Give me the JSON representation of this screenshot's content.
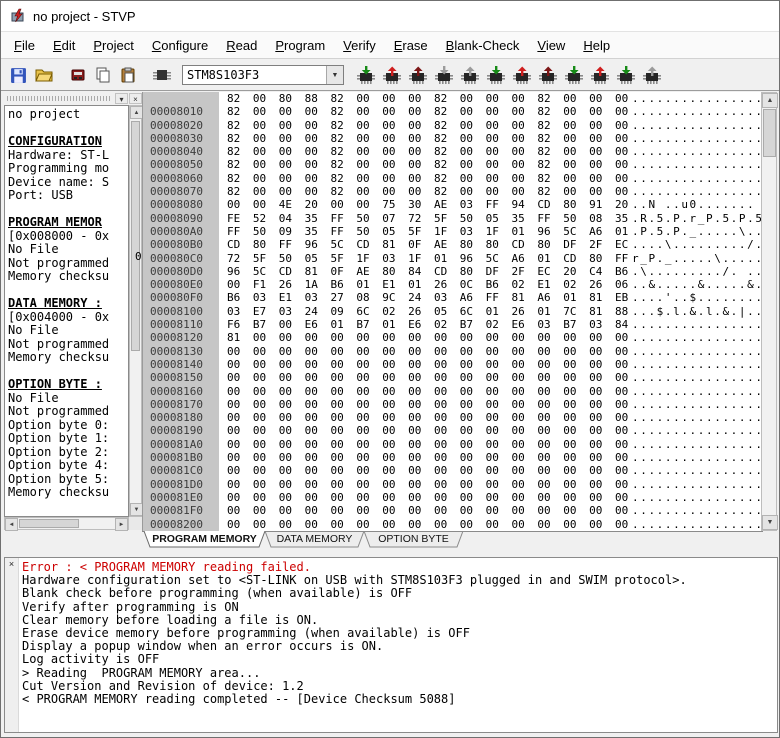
{
  "window": {
    "title": "no project - STVP"
  },
  "menu": {
    "items": [
      {
        "label": "File",
        "u": 0
      },
      {
        "label": "Edit",
        "u": 0
      },
      {
        "label": "Project",
        "u": 0
      },
      {
        "label": "Configure",
        "u": 0
      },
      {
        "label": "Read",
        "u": 0
      },
      {
        "label": "Program",
        "u": 0
      },
      {
        "label": "Verify",
        "u": 0
      },
      {
        "label": "Erase",
        "u": 0
      },
      {
        "label": "Blank-Check",
        "u": 0
      },
      {
        "label": "View",
        "u": 0
      },
      {
        "label": "Help",
        "u": 0
      }
    ]
  },
  "toolbar": {
    "left_icons": [
      "save",
      "open",
      "sep",
      "programmer",
      "copy",
      "paste",
      "sep",
      "chip"
    ],
    "device_value": "STM8S103F3",
    "chips": [
      {
        "color": "green",
        "dir": "down"
      },
      {
        "color": "red",
        "dir": "up"
      },
      {
        "color": "maroon",
        "dir": "up"
      },
      {
        "color": "gray",
        "dir": "down"
      },
      {
        "color": "gray",
        "dir": "up"
      },
      {
        "color": "green",
        "dir": "down"
      },
      {
        "color": "red",
        "dir": "up"
      },
      {
        "color": "maroon",
        "dir": "up"
      },
      {
        "color": "green",
        "dir": "down"
      },
      {
        "color": "red",
        "dir": "up"
      },
      {
        "color": "green",
        "dir": "down"
      },
      {
        "color": "gray",
        "dir": "up"
      }
    ]
  },
  "icons": {
    "arrow_up": "▲",
    "arrow_down": "▼",
    "arrow_left": "◄",
    "arrow_right": "►",
    "close": "×",
    "pin": "▾",
    "combo_arrow": "▼"
  },
  "sidebar": {
    "lines": [
      {
        "t": "no project",
        "s": "n"
      },
      {
        "t": "",
        "s": "b"
      },
      {
        "t": "CONFIGURATION",
        "s": "h"
      },
      {
        "t": "Hardware: ST-L",
        "s": "n"
      },
      {
        "t": "Programming mo",
        "s": "n"
      },
      {
        "t": "Device name: S",
        "s": "n"
      },
      {
        "t": "Port: USB",
        "s": "n"
      },
      {
        "t": "",
        "s": "b"
      },
      {
        "t": "PROGRAM MEMOR",
        "s": "h"
      },
      {
        "t": "[0x008000 - 0x",
        "s": "n"
      },
      {
        "t": "No File",
        "s": "n"
      },
      {
        "t": "Not programmed",
        "s": "n"
      },
      {
        "t": "Memory checksu",
        "s": "n"
      },
      {
        "t": "",
        "s": "b"
      },
      {
        "t": "DATA MEMORY :",
        "s": "h"
      },
      {
        "t": "[0x004000 - 0x",
        "s": "n"
      },
      {
        "t": "No File",
        "s": "n"
      },
      {
        "t": "Not programmed",
        "s": "n"
      },
      {
        "t": "Memory checksu",
        "s": "n"
      },
      {
        "t": "",
        "s": "b"
      },
      {
        "t": "OPTION BYTE :",
        "s": "h"
      },
      {
        "t": "No File",
        "s": "n"
      },
      {
        "t": "Not programmed",
        "s": "n"
      },
      {
        "t": "Option byte 0:",
        "s": "n"
      },
      {
        "t": "Option byte 1:",
        "s": "n"
      },
      {
        "t": "Option byte 2:",
        "s": "n"
      },
      {
        "t": "Option byte 4:",
        "s": "n"
      },
      {
        "t": "Option byte 5:",
        "s": "n"
      },
      {
        "t": "Memory checksu",
        "s": "n"
      }
    ]
  },
  "hex": {
    "rows": [
      {
        "a": "",
        "b": "82 00 80 88 82 00 00 00 82 00 00 00 82 00 00 00"
      },
      {
        "a": "00008010",
        "b": "82 00 00 00 82 00 00 00 82 00 00 00 82 00 00 00"
      },
      {
        "a": "00008020",
        "b": "82 00 00 00 82 00 00 00 82 00 00 00 82 00 00 00"
      },
      {
        "a": "00008030",
        "b": "82 00 00 00 82 00 00 00 82 00 00 00 82 00 00 00"
      },
      {
        "a": "00008040",
        "b": "82 00 00 00 82 00 00 00 82 00 00 00 82 00 00 00"
      },
      {
        "a": "00008050",
        "b": "82 00 00 00 82 00 00 00 82 00 00 00 82 00 00 00"
      },
      {
        "a": "00008060",
        "b": "82 00 00 00 82 00 00 00 82 00 00 00 82 00 00 00"
      },
      {
        "a": "00008070",
        "b": "82 00 00 00 82 00 00 00 82 00 00 00 82 00 00 00"
      },
      {
        "a": "00008080",
        "b": "00 00 4E 20 00 00 75 30 AE 03 FF 94 CD 80 91 20"
      },
      {
        "a": "00008090",
        "b": "FE 52 04 35 FF 50 07 72 5F 50 05 35 FF 50 08 35"
      },
      {
        "a": "000080A0",
        "b": "FF 50 09 35 FF 50 05 5F 1F 03 1F 01 96 5C A6 01"
      },
      {
        "a": "000080B0",
        "b": "CD 80 FF 96 5C CD 81 0F AE 80 80 CD 80 DF 2F EC"
      },
      {
        "a": "000080C0",
        "b": "72 5F 50 05 5F 1F 03 1F 01 96 5C A6 01 CD 80 FF"
      },
      {
        "a": "000080D0",
        "b": "96 5C CD 81 0F AE 80 84 CD 80 DF 2F EC 20 C4 B6"
      },
      {
        "a": "000080E0",
        "b": "00 F1 26 1A B6 01 E1 01 26 0C B6 02 E1 02 26 06"
      },
      {
        "a": "000080F0",
        "b": "B6 03 E1 03 27 08 9C 24 03 A6 FF 81 A6 01 81 EB"
      },
      {
        "a": "00008100",
        "b": "03 E7 03 24 09 6C 02 26 05 6C 01 26 01 7C 81 88"
      },
      {
        "a": "00008110",
        "b": "F6 B7 00 E6 01 B7 01 E6 02 B7 02 E6 03 B7 03 84"
      },
      {
        "a": "00008120",
        "b": "81 00 00 00 00 00 00 00 00 00 00 00 00 00 00 00"
      },
      {
        "a": "00008130",
        "b": "00 00 00 00 00 00 00 00 00 00 00 00 00 00 00 00"
      },
      {
        "a": "00008140",
        "b": "00 00 00 00 00 00 00 00 00 00 00 00 00 00 00 00"
      },
      {
        "a": "00008150",
        "b": "00 00 00 00 00 00 00 00 00 00 00 00 00 00 00 00"
      },
      {
        "a": "00008160",
        "b": "00 00 00 00 00 00 00 00 00 00 00 00 00 00 00 00"
      },
      {
        "a": "00008170",
        "b": "00 00 00 00 00 00 00 00 00 00 00 00 00 00 00 00"
      },
      {
        "a": "00008180",
        "b": "00 00 00 00 00 00 00 00 00 00 00 00 00 00 00 00"
      },
      {
        "a": "00008190",
        "b": "00 00 00 00 00 00 00 00 00 00 00 00 00 00 00 00"
      },
      {
        "a": "000081A0",
        "b": "00 00 00 00 00 00 00 00 00 00 00 00 00 00 00 00"
      },
      {
        "a": "000081B0",
        "b": "00 00 00 00 00 00 00 00 00 00 00 00 00 00 00 00"
      },
      {
        "a": "000081C0",
        "b": "00 00 00 00 00 00 00 00 00 00 00 00 00 00 00 00"
      },
      {
        "a": "000081D0",
        "b": "00 00 00 00 00 00 00 00 00 00 00 00 00 00 00 00"
      },
      {
        "a": "000081E0",
        "b": "00 00 00 00 00 00 00 00 00 00 00 00 00 00 00 00"
      },
      {
        "a": "000081F0",
        "b": "00 00 00 00 00 00 00 00 00 00 00 00 00 00 00 00"
      },
      {
        "a": "00008200",
        "b": "00 00 00 00 00 00 00 00 00 00 00 00 00 00 00 00"
      }
    ]
  },
  "tabs": [
    {
      "label": "PROGRAM MEMORY",
      "active": true
    },
    {
      "label": "DATA MEMORY",
      "active": false
    },
    {
      "label": "OPTION BYTE",
      "active": false
    }
  ],
  "log": {
    "lines": [
      {
        "text": "Error : < PROGRAM MEMORY reading failed.",
        "red": true
      },
      {
        "text": "Hardware configuration set to <ST-LINK on USB with STM8S103F3 plugged in and SWIM protocol>.",
        "red": false
      },
      {
        "text": "Blank check before programming (when available) is OFF",
        "red": false
      },
      {
        "text": "Verify after programming is ON",
        "red": false
      },
      {
        "text": "Clear memory before loading a file is ON.",
        "red": false
      },
      {
        "text": "Erase device memory before programming (when available) is OFF",
        "red": false
      },
      {
        "text": "Display a popup window when an error occurs is ON.",
        "red": false
      },
      {
        "text": "Log activity is OFF",
        "red": false
      },
      {
        "text": "> Reading  PROGRAM MEMORY area...",
        "red": false
      },
      {
        "text": "Cut Version and Revision of device: 1.2",
        "red": false
      },
      {
        "text": "< PROGRAM MEMORY reading completed -- [Device Checksum 5088]",
        "red": false
      }
    ]
  },
  "stray_char": "0",
  "colors": {
    "error_red": "#cc0000",
    "address_bg": "#c6c6c6"
  }
}
